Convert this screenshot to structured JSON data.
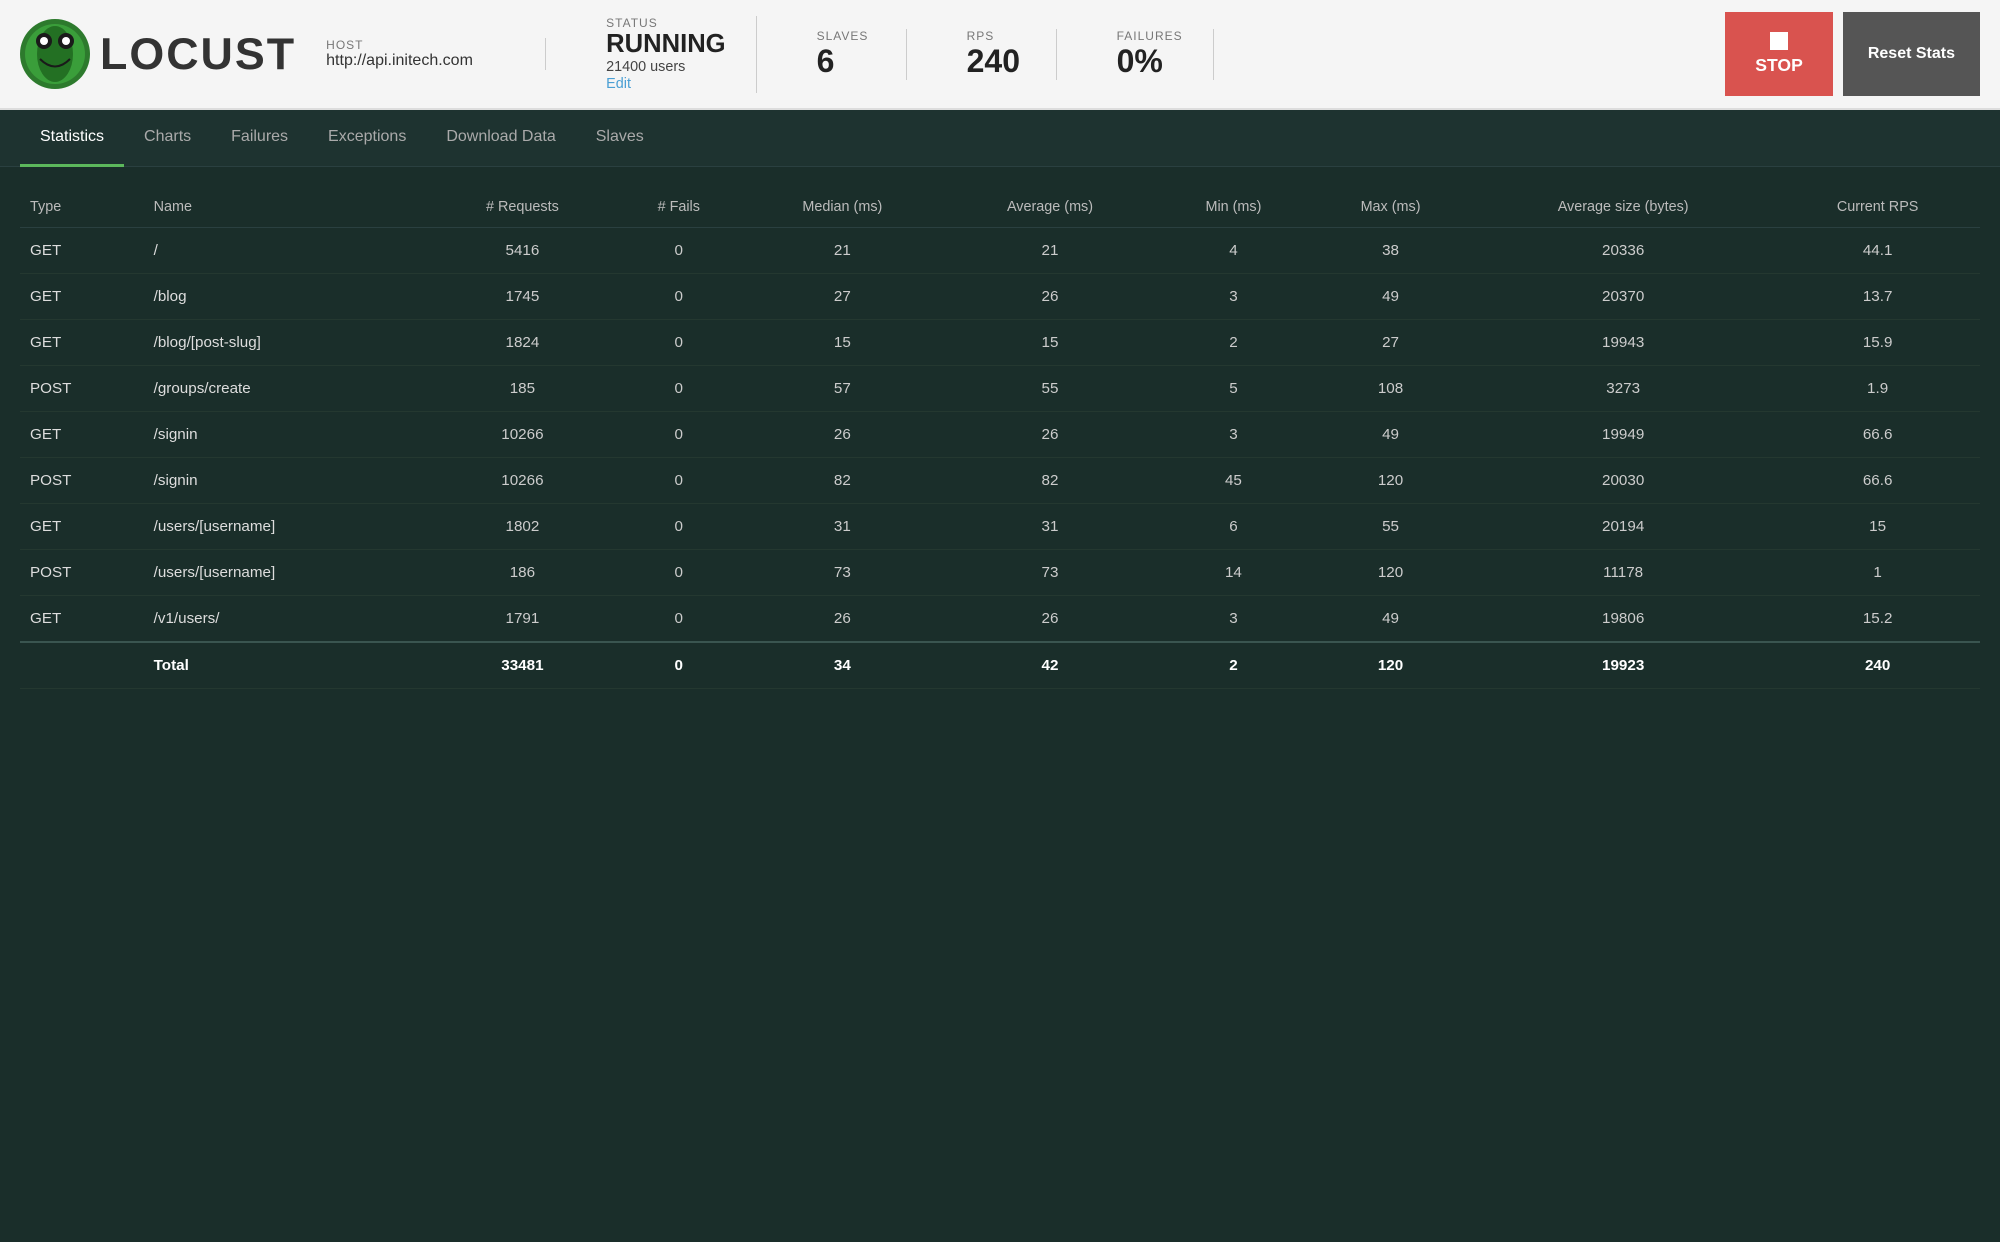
{
  "header": {
    "logo_text": "LOCUST",
    "host_label": "HOST",
    "host_value": "http://api.initech.com",
    "status_label": "STATUS",
    "status_running": "RUNNING",
    "status_users": "21400 users",
    "status_edit": "Edit",
    "slaves_label": "SLAVES",
    "slaves_value": "6",
    "rps_label": "RPS",
    "rps_value": "240",
    "failures_label": "FAILURES",
    "failures_value": "0%",
    "stop_button": "STOP",
    "reset_button": "Reset Stats"
  },
  "nav": {
    "tabs": [
      {
        "id": "statistics",
        "label": "Statistics",
        "active": true
      },
      {
        "id": "charts",
        "label": "Charts",
        "active": false
      },
      {
        "id": "failures",
        "label": "Failures",
        "active": false
      },
      {
        "id": "exceptions",
        "label": "Exceptions",
        "active": false
      },
      {
        "id": "download-data",
        "label": "Download Data",
        "active": false
      },
      {
        "id": "slaves",
        "label": "Slaves",
        "active": false
      }
    ]
  },
  "table": {
    "columns": [
      "Type",
      "Name",
      "# Requests",
      "# Fails",
      "Median (ms)",
      "Average (ms)",
      "Min (ms)",
      "Max (ms)",
      "Average size (bytes)",
      "Current RPS"
    ],
    "rows": [
      {
        "type": "GET",
        "name": "/",
        "requests": "5416",
        "fails": "0",
        "median": "21",
        "average": "21",
        "min": "4",
        "max": "38",
        "avg_size": "20336",
        "rps": "44.1"
      },
      {
        "type": "GET",
        "name": "/blog",
        "requests": "1745",
        "fails": "0",
        "median": "27",
        "average": "26",
        "min": "3",
        "max": "49",
        "avg_size": "20370",
        "rps": "13.7"
      },
      {
        "type": "GET",
        "name": "/blog/[post-slug]",
        "requests": "1824",
        "fails": "0",
        "median": "15",
        "average": "15",
        "min": "2",
        "max": "27",
        "avg_size": "19943",
        "rps": "15.9"
      },
      {
        "type": "POST",
        "name": "/groups/create",
        "requests": "185",
        "fails": "0",
        "median": "57",
        "average": "55",
        "min": "5",
        "max": "108",
        "avg_size": "3273",
        "rps": "1.9"
      },
      {
        "type": "GET",
        "name": "/signin",
        "requests": "10266",
        "fails": "0",
        "median": "26",
        "average": "26",
        "min": "3",
        "max": "49",
        "avg_size": "19949",
        "rps": "66.6"
      },
      {
        "type": "POST",
        "name": "/signin",
        "requests": "10266",
        "fails": "0",
        "median": "82",
        "average": "82",
        "min": "45",
        "max": "120",
        "avg_size": "20030",
        "rps": "66.6"
      },
      {
        "type": "GET",
        "name": "/users/[username]",
        "requests": "1802",
        "fails": "0",
        "median": "31",
        "average": "31",
        "min": "6",
        "max": "55",
        "avg_size": "20194",
        "rps": "15"
      },
      {
        "type": "POST",
        "name": "/users/[username]",
        "requests": "186",
        "fails": "0",
        "median": "73",
        "average": "73",
        "min": "14",
        "max": "120",
        "avg_size": "11178",
        "rps": "1"
      },
      {
        "type": "GET",
        "name": "/v1/users/",
        "requests": "1791",
        "fails": "0",
        "median": "26",
        "average": "26",
        "min": "3",
        "max": "49",
        "avg_size": "19806",
        "rps": "15.2"
      }
    ],
    "total": {
      "label": "Total",
      "requests": "33481",
      "fails": "0",
      "median": "34",
      "average": "42",
      "min": "2",
      "max": "120",
      "avg_size": "19923",
      "rps": "240"
    }
  }
}
